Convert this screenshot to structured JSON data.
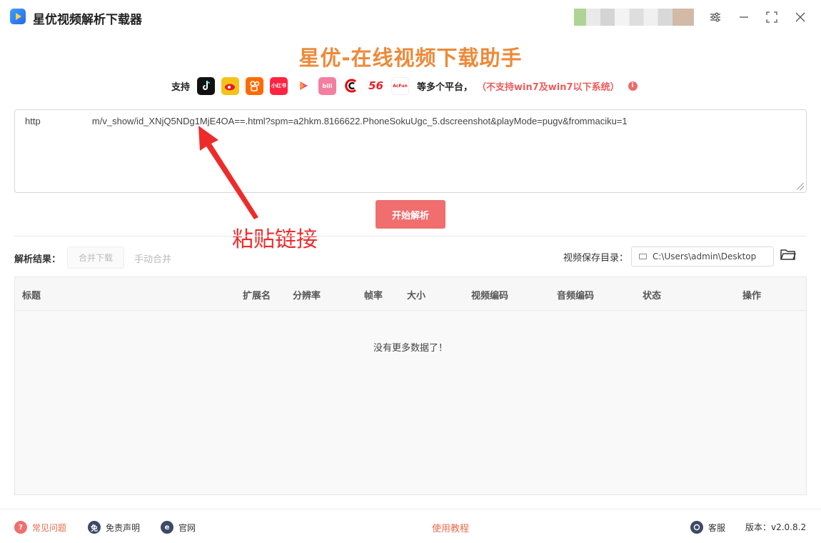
{
  "window": {
    "title": "星优视频解析下载器"
  },
  "header": {
    "main_title": "星优-在线视频下载助手",
    "support_label": "支持",
    "platforms": [
      {
        "icon": "douyin-icon",
        "color": "#111111",
        "text": "♪"
      },
      {
        "icon": "weibo-icon",
        "color": "#f5c218",
        "text": "微"
      },
      {
        "icon": "kuaishou-icon",
        "color": "#ff6a00",
        "text": "快"
      },
      {
        "icon": "xiaohongshu-icon",
        "color": "#ff2442",
        "text": "小红书"
      },
      {
        "icon": "xigua-icon",
        "color": "#ffffff",
        "text": "▶"
      },
      {
        "icon": "bilibili-icon",
        "color": "#f47ea1",
        "text": "bili"
      },
      {
        "icon": "cctv-icon",
        "color": "#ffffff",
        "text": "C"
      },
      {
        "icon": "56-icon",
        "color": "#ffffff",
        "text": "56"
      },
      {
        "icon": "acfun-icon",
        "color": "#ffffff",
        "text": "AcFun"
      }
    ],
    "more_platforms": "等多个平台，",
    "warning": "（不支持win7及win7以下系统）"
  },
  "input": {
    "url_value": "http                    m/v_show/id_XNjQ5NDg1MjE4OA==.html?spm=a2hkm.8166622.PhoneSokuUgc_5.dscreenshot&playMode=pugv&frommaciku=1"
  },
  "actions": {
    "start_label": "开始解析"
  },
  "annotation": {
    "text": "粘贴链接"
  },
  "results": {
    "label": "解析结果：",
    "merge_download": "合并下载",
    "manual_merge": "手动合并",
    "save_dir_label": "视频保存目录：",
    "save_dir_value": "C:\\Users\\admin\\Desktop"
  },
  "table": {
    "columns": [
      "标题",
      "扩展名",
      "分辨率",
      "帧率",
      "大小",
      "视频编码",
      "音频编码",
      "状态",
      "操作"
    ],
    "empty_text": "没有更多数据了！"
  },
  "footer": {
    "faq": "常见问题",
    "disclaimer": "免责声明",
    "website": "官网",
    "tutorial": "使用教程",
    "service": "客服",
    "version": "版本：v2.0.8.2"
  }
}
